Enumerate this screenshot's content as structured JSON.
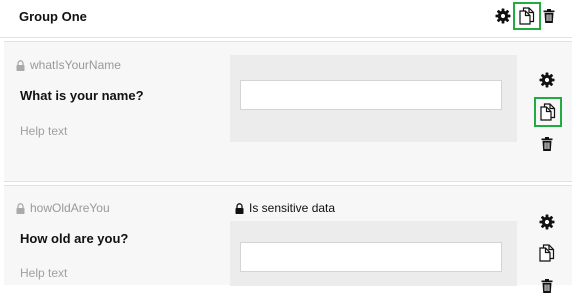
{
  "group": {
    "title": "Group One",
    "actions": [
      "gear-icon",
      "copy-icon",
      "trash-icon"
    ]
  },
  "questions": [
    {
      "key": "whatIsYourName",
      "text": "What is your name?",
      "help": "Help text",
      "answer_value": "",
      "actions": [
        "gear-icon",
        "copy-icon",
        "trash-icon"
      ]
    },
    {
      "key": "howOldAreYou",
      "text": "How old are you?",
      "help": "Help text",
      "sensitive_label": "Is sensitive data",
      "answer_value": "",
      "actions": [
        "gear-icon",
        "copy-icon",
        "trash-icon"
      ]
    }
  ],
  "colors": {
    "highlight": "#22aa44",
    "card_bg": "#f7f7f7",
    "panel_bg": "#ececec"
  }
}
